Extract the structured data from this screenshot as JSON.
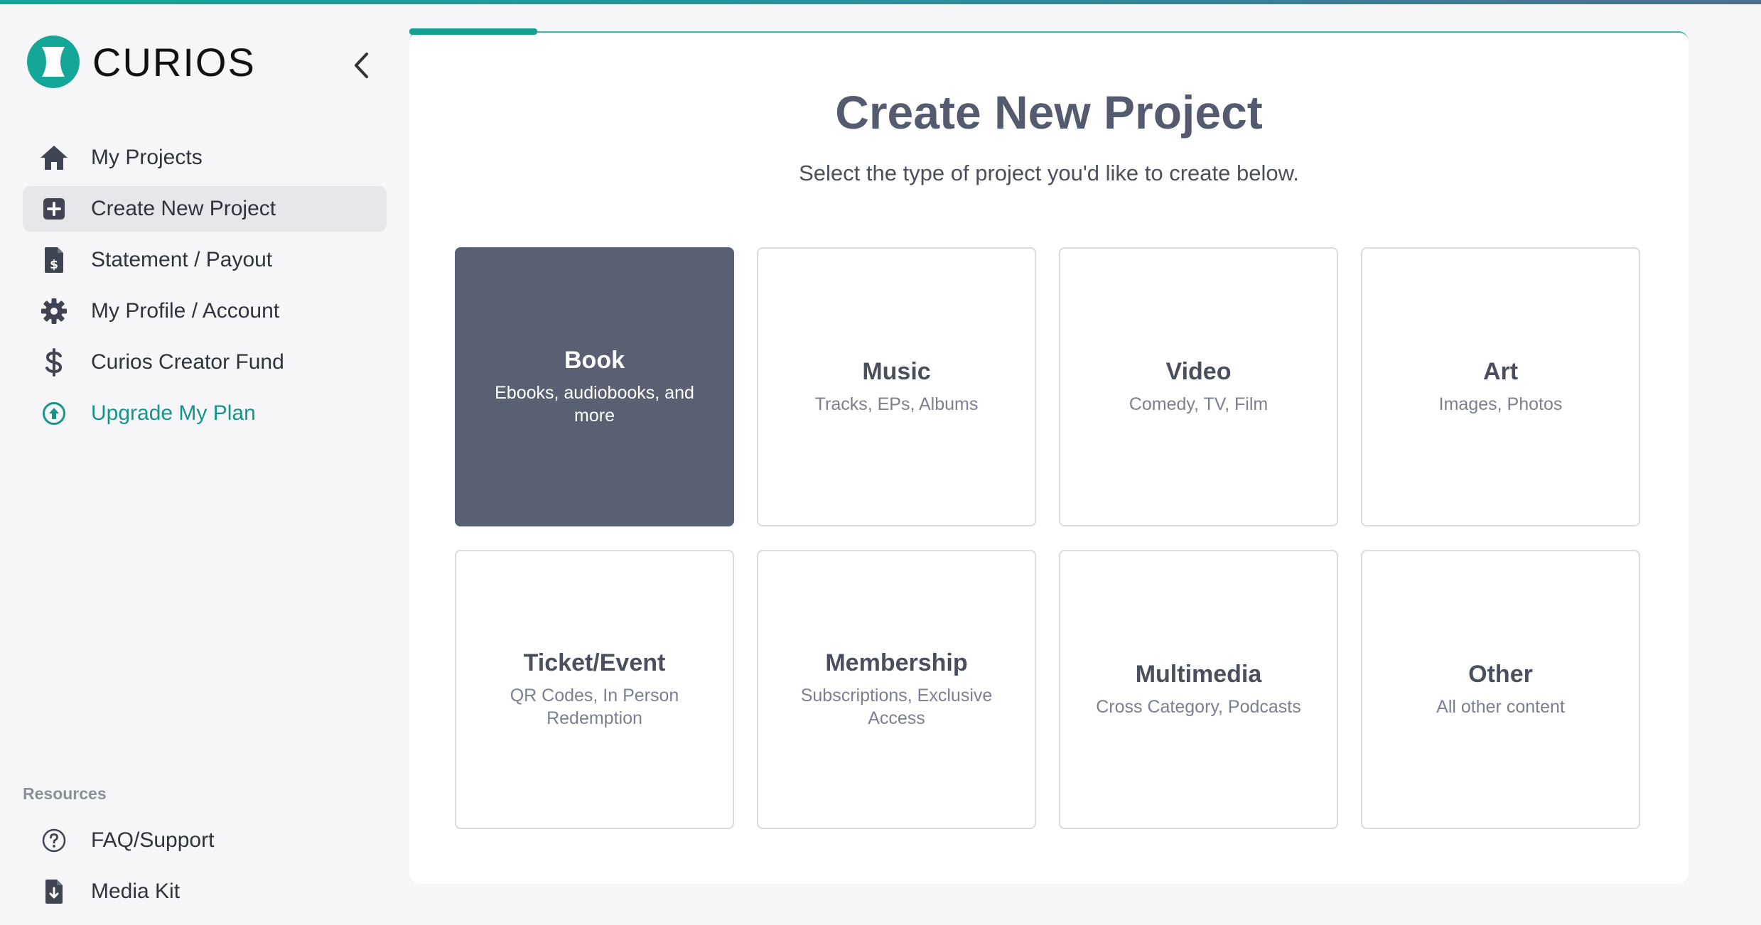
{
  "app": {
    "logo_text": "CURIOS"
  },
  "sidebar": {
    "items": [
      {
        "label": "My Projects",
        "icon": "home-icon"
      },
      {
        "label": "Create New Project",
        "icon": "plus-square-icon",
        "active": true
      },
      {
        "label": "Statement / Payout",
        "icon": "invoice-dollar-icon"
      },
      {
        "label": "My Profile / Account",
        "icon": "gear-icon"
      },
      {
        "label": "Curios Creator Fund",
        "icon": "dollar-icon"
      },
      {
        "label": "Upgrade My Plan",
        "icon": "arrow-up-circle-icon"
      }
    ],
    "resources_title": "Resources",
    "resources": [
      {
        "label": "FAQ/Support",
        "icon": "question-circle-icon"
      },
      {
        "label": "Media Kit",
        "icon": "file-download-icon"
      }
    ]
  },
  "main": {
    "title": "Create New Project",
    "subtitle": "Select the type of project you'd like to create below.",
    "cards": [
      {
        "title": "Book",
        "subtitle": "Ebooks, audiobooks, and more",
        "selected": true
      },
      {
        "title": "Music",
        "subtitle": "Tracks, EPs, Albums"
      },
      {
        "title": "Video",
        "subtitle": "Comedy, TV, Film"
      },
      {
        "title": "Art",
        "subtitle": "Images, Photos"
      },
      {
        "title": "Ticket/Event",
        "subtitle": "QR Codes, In Person Redemption"
      },
      {
        "title": "Membership",
        "subtitle": "Subscriptions, Exclusive Access"
      },
      {
        "title": "Multimedia",
        "subtitle": "Cross Category, Podcasts"
      },
      {
        "title": "Other",
        "subtitle": "All other content"
      }
    ]
  },
  "colors": {
    "accent": "#14a697",
    "selected_card": "#586072",
    "upgrade_text": "#15958a"
  }
}
